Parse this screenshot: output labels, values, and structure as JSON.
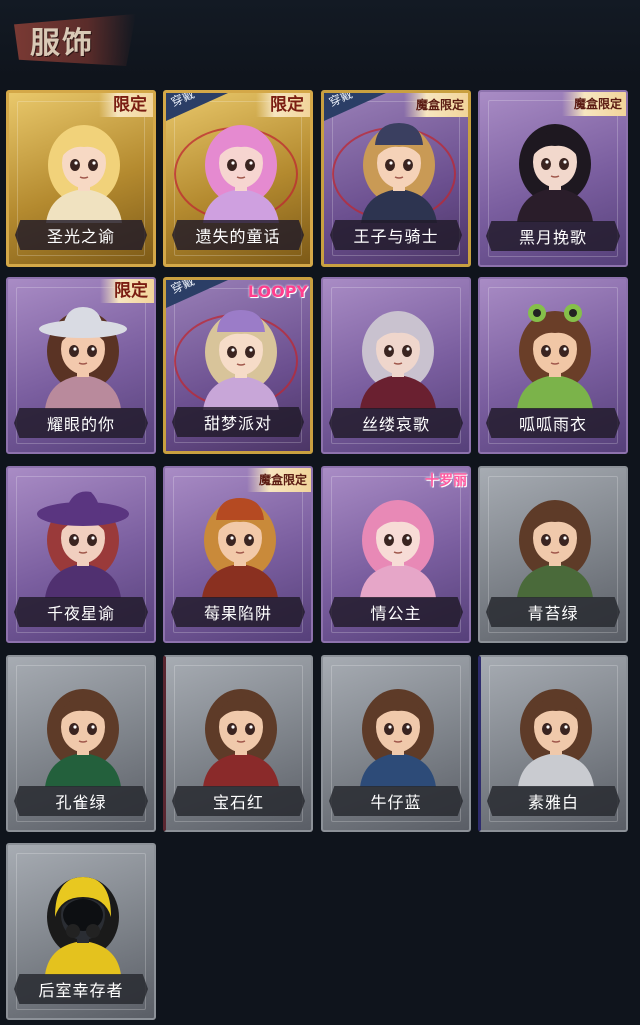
{
  "title": "服饰",
  "cards": [
    {
      "name": "圣光之谕",
      "tag": "限定",
      "tag_type": "xd",
      "style": "gold",
      "worn": false,
      "logo": null,
      "hair": "#f1d27a",
      "skin": "#f7d9c4",
      "outfit": "#f0e2c0",
      "hat": null
    },
    {
      "name": "遗失的童话",
      "tag": "限定",
      "tag_type": "xd",
      "style": "gold",
      "worn": true,
      "logo": null,
      "hair": "#e58ad0",
      "skin": "#f6d5d0",
      "outfit": "#cfa0e0",
      "hat": null
    },
    {
      "name": "王子与骑士",
      "tag": "魔盒限定",
      "tag_type": "mh",
      "style": "goldp",
      "worn": true,
      "logo": null,
      "hair": "#c99a55",
      "skin": "#f5d2b8",
      "outfit": "#2d3450",
      "hat": "#3a3f60"
    },
    {
      "name": "黑月挽歌",
      "tag": "魔盒限定",
      "tag_type": "mh",
      "style": "purple",
      "worn": false,
      "logo": null,
      "hair": "#1e1820",
      "skin": "#f2d8cc",
      "outfit": "#2a1d2a",
      "hat": null
    },
    {
      "name": "耀眼的你",
      "tag": "限定",
      "tag_type": "xd",
      "style": "purple",
      "worn": false,
      "logo": null,
      "hair": "#5a3324",
      "skin": "#f3c9ad",
      "outfit": "#b98a9c",
      "hat": "#d9dbe3"
    },
    {
      "name": "甜梦派对",
      "tag": "",
      "tag_type": "",
      "style": "goldp",
      "worn": true,
      "logo": "LOOPY",
      "hair": "#d8c49a",
      "skin": "#f6dcc8",
      "outfit": "#c8a6d8",
      "hat": "#9b7cc8"
    },
    {
      "name": "丝缕哀歌",
      "tag": "",
      "tag_type": "",
      "style": "purple",
      "worn": false,
      "logo": null,
      "hair": "#c9c2cf",
      "skin": "#efd6cc",
      "outfit": "#6a2030",
      "hat": null
    },
    {
      "name": "呱呱雨衣",
      "tag": "",
      "tag_type": "",
      "style": "purple",
      "worn": false,
      "logo": null,
      "hair": "#6a3e28",
      "skin": "#f1c7a6",
      "outfit": "#7bb34a",
      "hat": "#85c04a"
    },
    {
      "name": "千夜星谕",
      "tag": "",
      "tag_type": "",
      "style": "purple",
      "worn": false,
      "logo": null,
      "hair": "#9a3a3a",
      "skin": "#f1cfbf",
      "outfit": "#503070",
      "hat": "#5a3580"
    },
    {
      "name": "莓果陷阱",
      "tag": "魔盒限定",
      "tag_type": "mh",
      "style": "purple",
      "worn": false,
      "logo": null,
      "hair": "#c98a3a",
      "skin": "#f2c9a9",
      "outfit": "#8a3020",
      "hat": "#b54a22"
    },
    {
      "name": "情公主",
      "tag": "",
      "tag_type": "",
      "style": "purple",
      "worn": false,
      "logo": "十罗丽",
      "hair": "#e889b6",
      "skin": "#f7dcd6",
      "outfit": "#e6a6c8",
      "hat": null
    },
    {
      "name": "青苔绿",
      "tag": "",
      "tag_type": "",
      "style": "gray",
      "worn": false,
      "logo": null,
      "hair": "#5e3b28",
      "skin": "#f0c9ab",
      "outfit": "#4a6a3a",
      "hat": null
    },
    {
      "name": "孔雀绿",
      "tag": "",
      "tag_type": "",
      "style": "gray",
      "worn": false,
      "logo": null,
      "hair": "#5e3b28",
      "skin": "#f0c9ab",
      "outfit": "#23603c",
      "hat": null
    },
    {
      "name": "宝石红",
      "tag": "",
      "tag_type": "",
      "style": "grayred",
      "worn": false,
      "logo": null,
      "hair": "#5e3b28",
      "skin": "#f0c9ab",
      "outfit": "#8a2a2a",
      "hat": null
    },
    {
      "name": "牛仔蓝",
      "tag": "",
      "tag_type": "",
      "style": "gray",
      "worn": false,
      "logo": null,
      "hair": "#5e3b28",
      "skin": "#f0c9ab",
      "outfit": "#2d4b78",
      "hat": null
    },
    {
      "name": "素雅白",
      "tag": "",
      "tag_type": "",
      "style": "grayblue",
      "worn": false,
      "logo": null,
      "hair": "#5e3b28",
      "skin": "#f0c9ab",
      "outfit": "#c9cbd0",
      "hat": null
    },
    {
      "name": "后室幸存者",
      "tag": "",
      "tag_type": "",
      "style": "gray",
      "worn": false,
      "logo": null,
      "hair": "#1a1a1a",
      "skin": "#2a2d33",
      "outfit": "#e4c21e",
      "hat": "#e8c820"
    }
  ],
  "worn_label": "穿戴"
}
